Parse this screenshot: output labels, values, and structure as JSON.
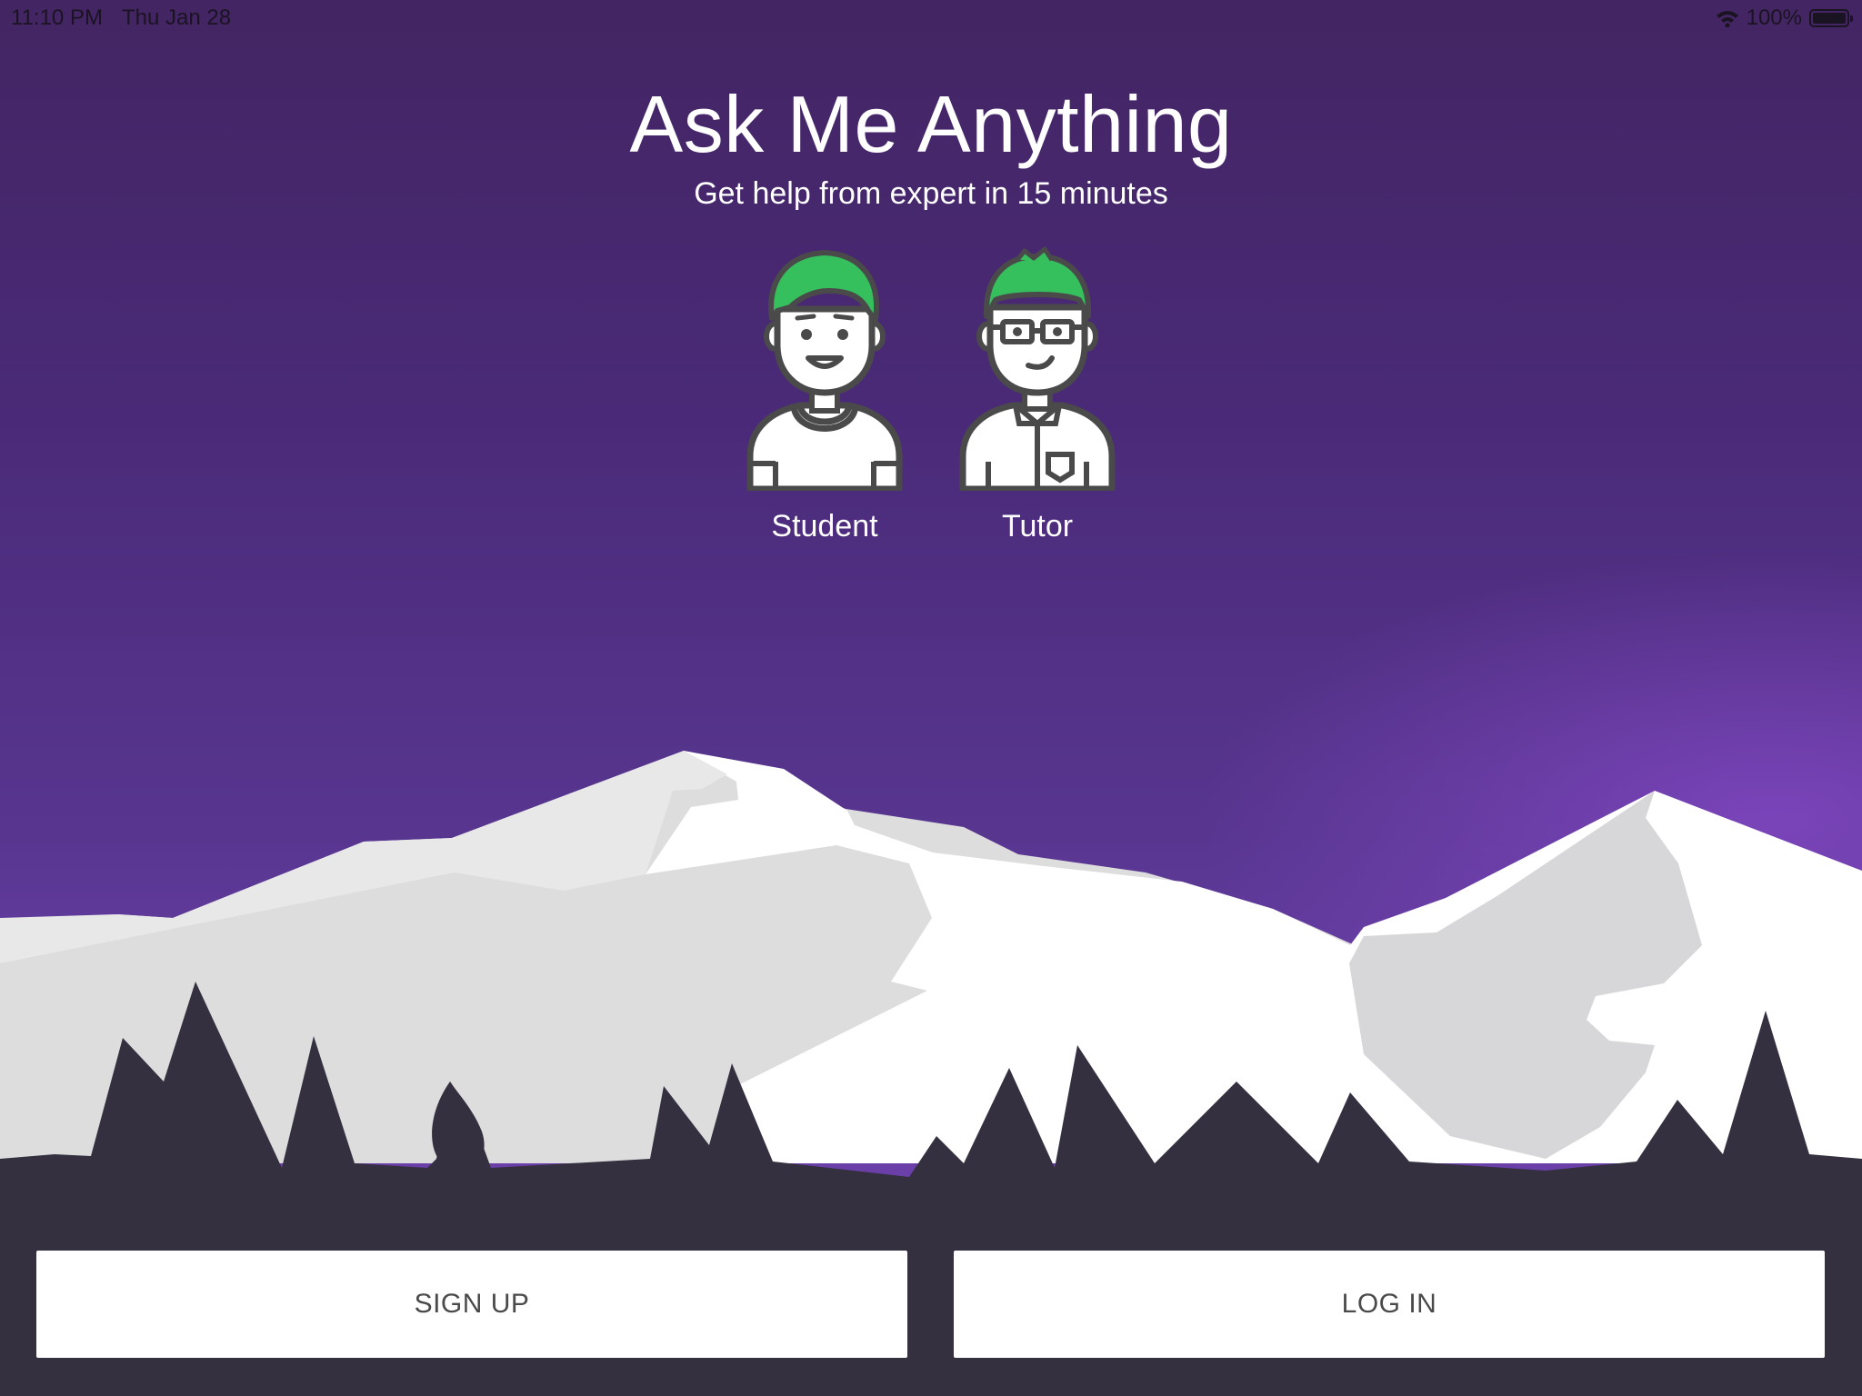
{
  "status_bar": {
    "time": "11:10 PM",
    "date": "Thu Jan 28",
    "battery": "100%",
    "battery_level": 1.0
  },
  "header": {
    "title": "Ask Me Anything",
    "subtitle": "Get help from expert in 15  minutes"
  },
  "roles": [
    {
      "label": "Student",
      "icon": "student-avatar-icon"
    },
    {
      "label": "Tutor",
      "icon": "tutor-avatar-icon"
    }
  ],
  "actions": {
    "signup_label": "SIGN UP",
    "login_label": "LOG IN"
  },
  "colors": {
    "sky_top": "#432563",
    "sky_bottom": "#6a3fa8",
    "ground": "#34303f",
    "hair": "#35c05d",
    "button_bg": "#ffffff",
    "button_text": "#4a4a4a"
  }
}
